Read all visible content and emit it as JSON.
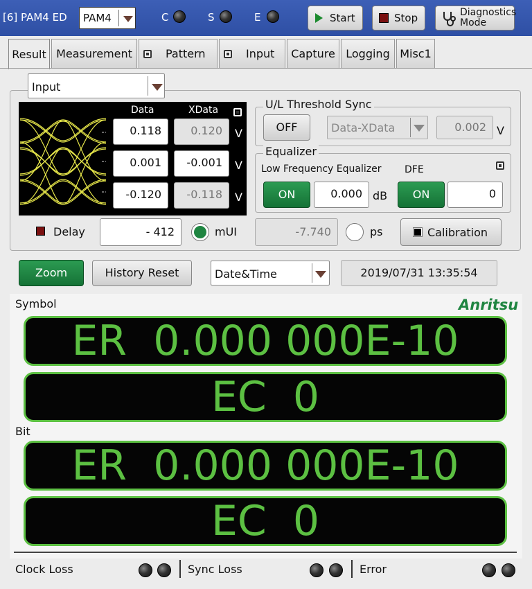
{
  "title_bar": {
    "instrument": "[6] PAM4 ED",
    "mode_value": "PAM4",
    "indicators": [
      {
        "label": "C",
        "icon": "led-off-icon"
      },
      {
        "label": "S",
        "icon": "led-off-icon"
      },
      {
        "label": "E",
        "icon": "led-off-icon"
      }
    ],
    "start_label": "Start",
    "stop_label": "Stop",
    "diag_label_line1": "Diagnostics",
    "diag_label_line2": "Mode"
  },
  "tabs": [
    {
      "label": "Result",
      "active": true,
      "badge": false
    },
    {
      "label": "Measurement",
      "active": false,
      "badge": false
    },
    {
      "label": "Pattern",
      "active": false,
      "badge": true
    },
    {
      "label": "Input",
      "active": false,
      "badge": true
    },
    {
      "label": "Capture",
      "active": false,
      "badge": false
    },
    {
      "label": "Logging",
      "active": false,
      "badge": false
    },
    {
      "label": "Misc1",
      "active": false,
      "badge": false
    }
  ],
  "input_panel": {
    "source_select": "Input",
    "col_data": "Data",
    "col_xdata": "XData",
    "rows": [
      {
        "data": "0.118",
        "xdata": "0.120",
        "unit": "V"
      },
      {
        "data": "0.001",
        "xdata": "-0.001",
        "unit": "V"
      },
      {
        "data": "-0.120",
        "xdata": "-0.118",
        "unit": "V"
      }
    ],
    "delay_label": "Delay",
    "delay_value": "- 412",
    "delay_unit": "mUI",
    "ps_value": "-7.740",
    "ps_unit": "ps",
    "calibration_label": "Calibration"
  },
  "threshold_sync": {
    "title": "U/L Threshold Sync",
    "toggle_label": "OFF",
    "select_value": "Data-XData",
    "value": "0.002",
    "unit": "V"
  },
  "equalizer": {
    "title": "Equalizer",
    "lfe_label": "Low Frequency Equalizer",
    "lfe_toggle": "ON",
    "lfe_value": "0.000",
    "lfe_unit": "dB",
    "dfe_label": "DFE",
    "dfe_toggle": "ON",
    "dfe_value": "0"
  },
  "toolbar": {
    "zoom_label": "Zoom",
    "history_reset_label": "History Reset",
    "time_select": "Date&Time",
    "timestamp": "2019/07/31 13:35:54"
  },
  "results": {
    "brand": "Anritsu",
    "symbol_label": "Symbol",
    "symbol_er": "ER  0.000 000E-10",
    "symbol_ec": "EC  0",
    "bit_label": "Bit",
    "bit_er": "ER  0.000 000E-10",
    "bit_ec": "EC  0"
  },
  "status_bar": {
    "clock_loss": "Clock Loss",
    "sync_loss": "Sync Loss",
    "error": "Error"
  },
  "colors": {
    "title_bar": "#3355aa",
    "green_button": "#1f8541",
    "display_green": "#5cc042",
    "eye_yellow": "#e6e64a"
  }
}
